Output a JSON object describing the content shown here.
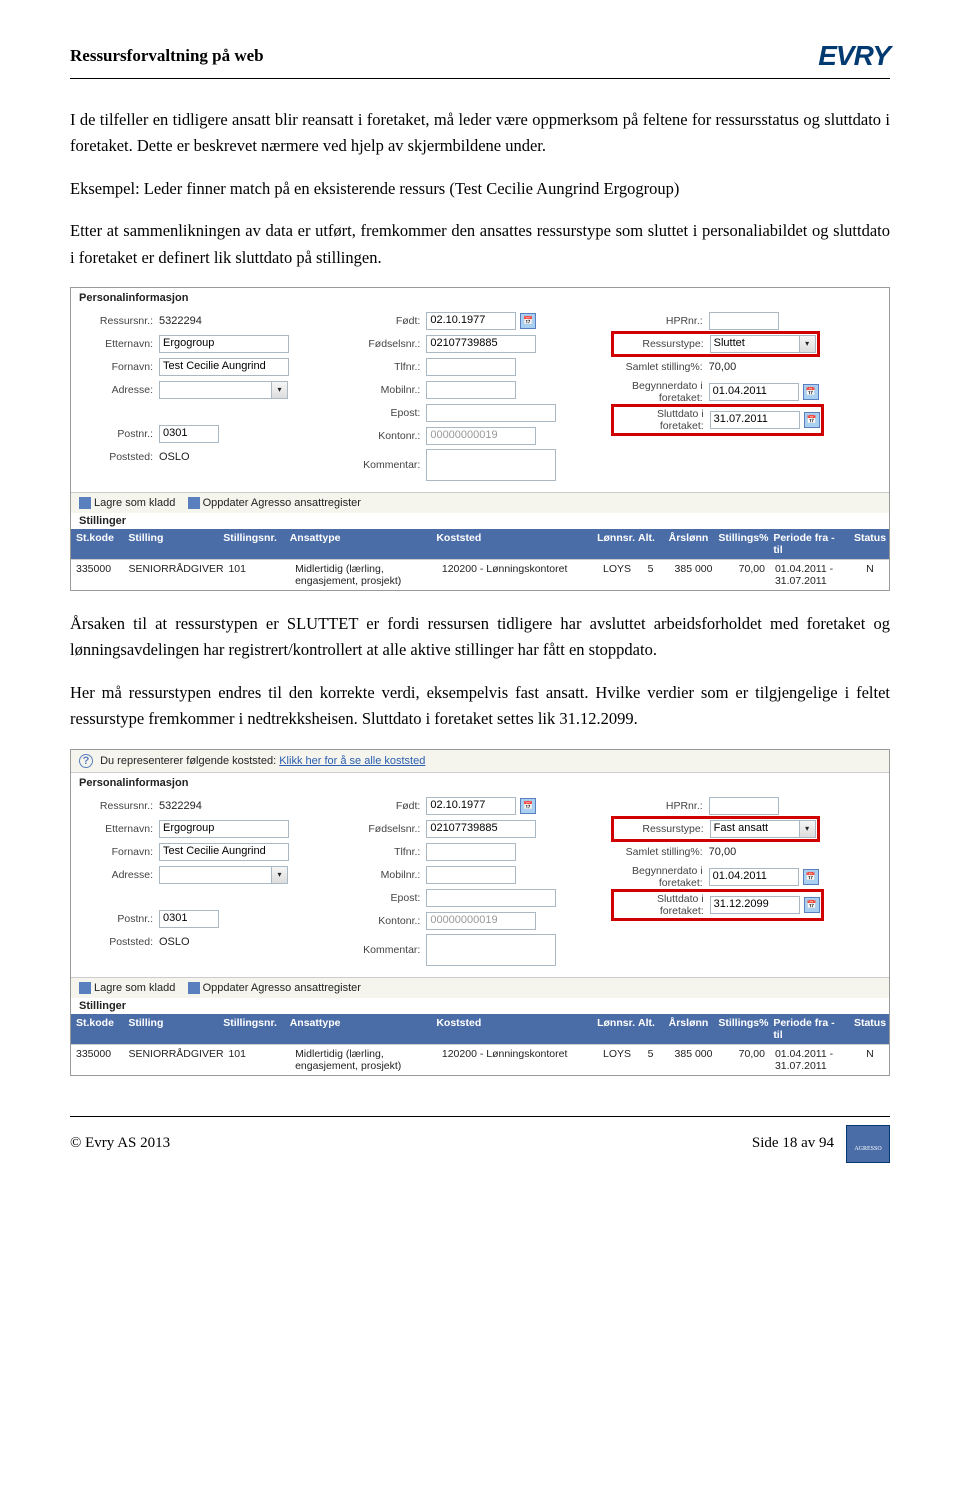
{
  "header": {
    "title": "Ressursforvaltning på web",
    "logo_text": "EVRY"
  },
  "body": {
    "p1": "I de tilfeller en tidligere ansatt blir reansatt i foretaket, må leder være oppmerksom på feltene for ressursstatus og sluttdato i foretaket. Dette er beskrevet nærmere ved hjelp av skjermbildene under.",
    "p2": "Eksempel: Leder finner match på en eksisterende ressurs (Test Cecilie Aungrind Ergogroup)",
    "p3": "Etter at sammenlikningen av data er utført, fremkommer den ansattes ressurstype som sluttet i personaliabildet og sluttdato i foretaket er definert lik sluttdato på stillingen.",
    "p4": "Årsaken til at ressurstypen er SLUTTET er fordi ressursen tidligere har avsluttet arbeidsforholdet med foretaket og lønningsavdelingen har registrert/kontrollert at alle aktive stillinger har fått en stoppdato.",
    "p5": "Her må ressurstypen endres til den korrekte verdi, eksempelvis fast ansatt. Hvilke verdier som er tilgjengelige i feltet ressurstype fremkommer i nedtrekksheisen. Sluttdato i foretaket settes lik 31.12.2099."
  },
  "form_labels": {
    "personal_info": "Personalinformasjon",
    "ressursnr": "Ressursnr.:",
    "etternavn": "Etternavn:",
    "fornavn": "Fornavn:",
    "adresse": "Adresse:",
    "postnr": "Postnr.:",
    "poststed": "Poststed:",
    "fodt": "Født:",
    "fodselsnr": "Fødselsnr.:",
    "tlfnr": "Tlfnr.:",
    "mobilnr": "Mobilnr.:",
    "epost": "Epost:",
    "kontonr": "Kontonr.:",
    "kommentar": "Kommentar:",
    "hprnr": "HPRnr.:",
    "ressurstype": "Ressurstype:",
    "samlet_stilling": "Samlet stilling%:",
    "begynnerdato": "Begynnerdato i foretaket:",
    "sluttdato": "Sluttdato i foretaket:"
  },
  "form_values": {
    "ressursnr": "5322294",
    "etternavn": "Ergogroup",
    "fornavn": "Test Cecilie Aungrind",
    "postnr": "0301",
    "poststed": "OSLO",
    "fodt": "02.10.1977",
    "fodselsnr": "02107739885",
    "kontonr": "00000000019",
    "samlet_stilling": "70,00",
    "begynnerdato": "01.04.2011"
  },
  "form1": {
    "ressurstype": "Sluttet",
    "sluttdato": "31.07.2011"
  },
  "form2": {
    "info_bar_pre": "Du representerer følgende koststed:",
    "info_bar_link": "Klikk her for å se alle koststed",
    "ressurstype": "Fast ansatt",
    "sluttdato": "31.12.2099"
  },
  "actions": {
    "lagre": "Lagre som kladd",
    "oppdater": "Oppdater Agresso ansattregister"
  },
  "stillinger": {
    "title": "Stillinger",
    "hdr": {
      "stkode": "St.kode",
      "stilling": "Stilling",
      "stillingsnr": "Stillingsnr.",
      "ansattype": "Ansattype",
      "koststed": "Koststed",
      "lonnsr": "Lønnsr.",
      "alt": "Alt.",
      "arslonn": "Årslønn",
      "stillingspct": "Stillings%",
      "periode": "Periode fra - til",
      "status": "Status"
    },
    "row": {
      "stkode": "335000",
      "stilling": "SENIORRÅDGIVER",
      "stillingsnr": "101",
      "ansattype": "Midlertidig (lærling, engasjement, prosjekt)",
      "koststed": "120200 - Lønningskontoret",
      "lonnsr": "LOYS",
      "alt": "5",
      "arslonn": "385 000",
      "stillingspct": "70,00",
      "periode": "01.04.2011 - 31.07.2011",
      "status": "N"
    }
  },
  "footer": {
    "left": "© Evry AS 2013",
    "right": "Side 18 av 94",
    "badge": "AGRESSO"
  }
}
